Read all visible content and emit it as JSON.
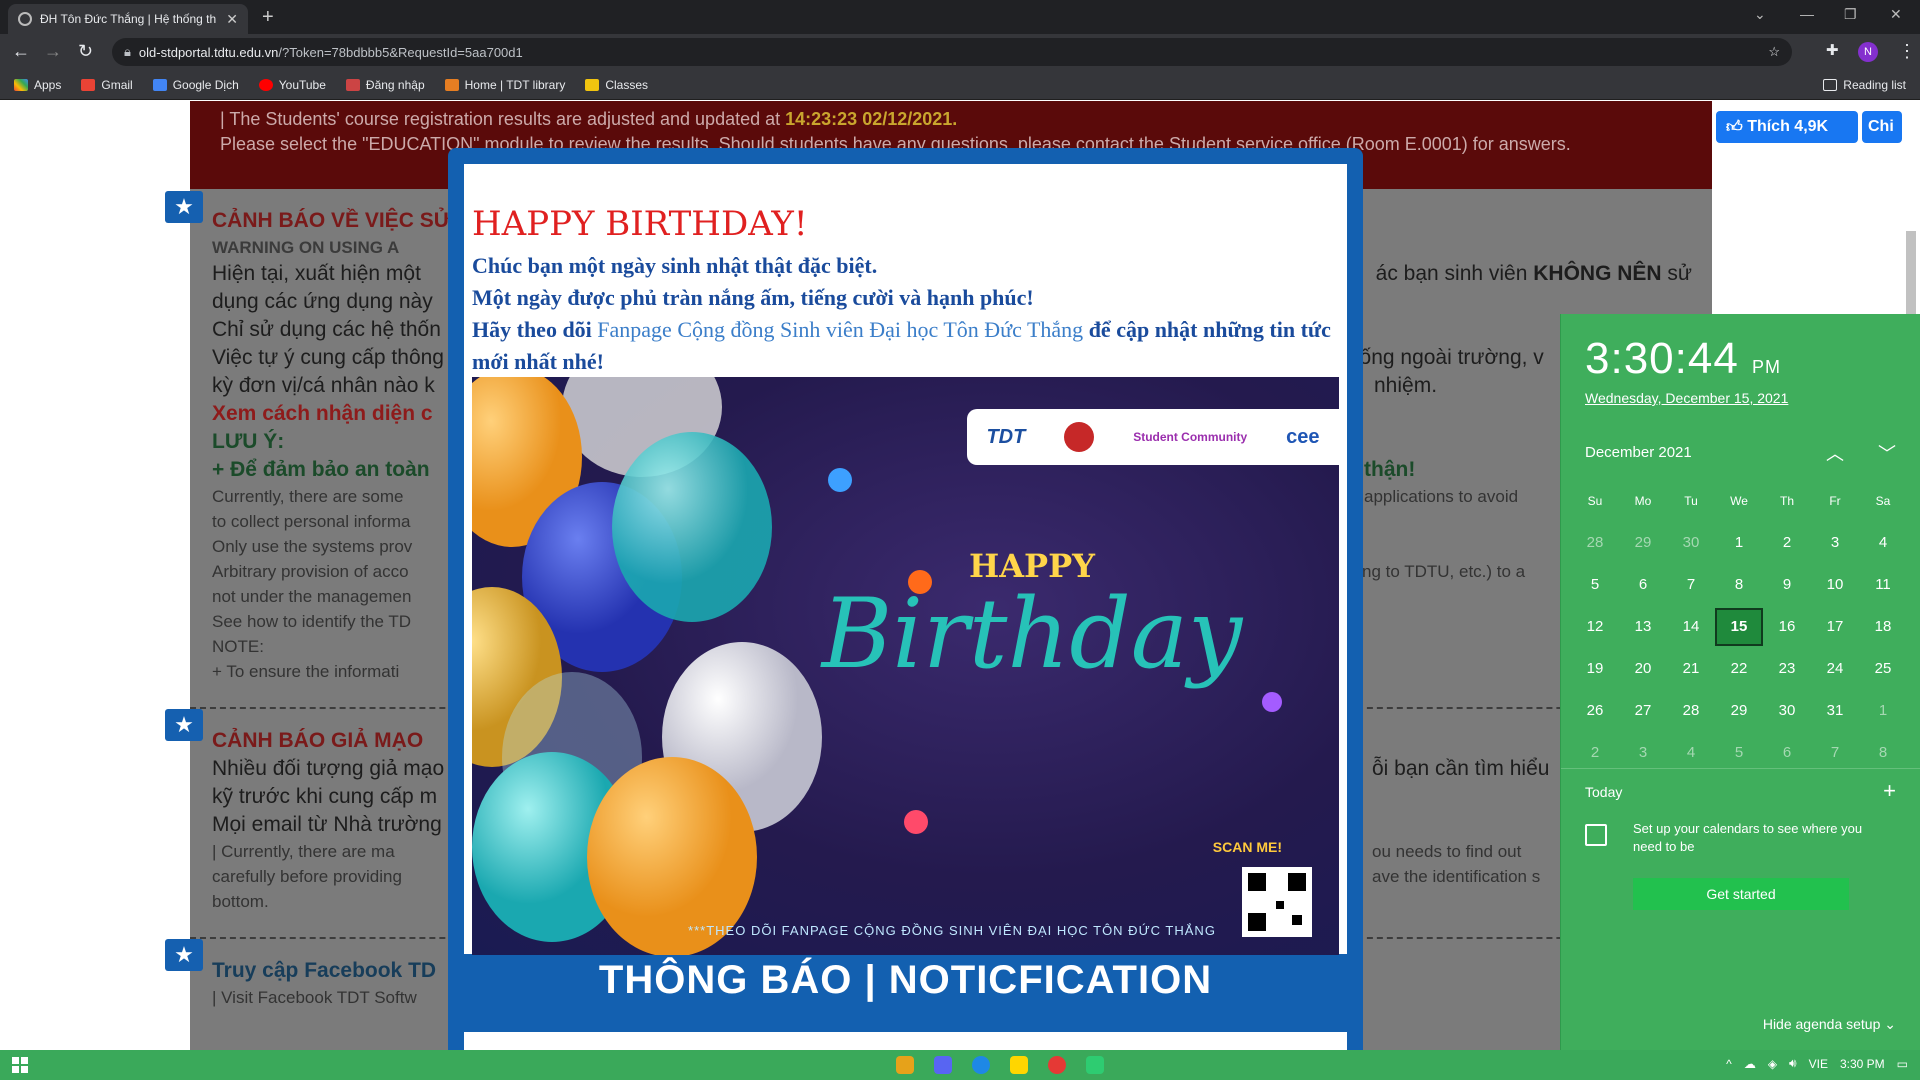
{
  "browser": {
    "tab_title": "ĐH Tôn Đức Thắng | Hệ thống th",
    "url_host": "old-stdportal.tdtu.edu.vn",
    "url_path": "/?Token=78bdbbb5&RequestId=5aa700d1",
    "bookmarks": [
      "Apps",
      "Gmail",
      "Google Dịch",
      "YouTube",
      "Đăng nhập",
      "Home | TDT library",
      "Classes"
    ],
    "reading_list": "Reading list",
    "profile_initial": "N"
  },
  "page": {
    "banner_line1_prefix": "| The Students' course registration results are adjusted and updated at ",
    "banner_line1_time": "14:23:23 02/12/2021.",
    "banner_line2": "Please select the \"EDUCATION\" module to review the results. Should students have any questions, please contact the Student service office (Room E.0001) for answers.",
    "fb_like": "Thích 4,9K",
    "fb_share": "Chi",
    "s1_title": "CẢNH BÁO VỀ VIỆC SỬ",
    "s1_title_en": "WARNING ON USING A",
    "s1_l1": "Hiện tại, xuất hiện một",
    "s1_l1_right_a": "ác bạn sinh viên ",
    "s1_l1_right_b": "KHÔNG NÊN",
    "s1_l1_right_c": " sử",
    "s1_l2": "dụng các ứng dụng này",
    "s1_l3": "Chỉ sử dụng các hệ thốn",
    "s1_l4": "Việc tự ý cung cấp thông",
    "s1_l4_right": "thống ngoài trường, v",
    "s1_l5": "kỳ đơn vị/cá nhân nào k",
    "s1_l5_right": "nhiệm.",
    "s1_link": "Xem cách nhận diện c",
    "s1_note": "LƯU Ý:",
    "s1_ensure": "+ Để đảm bảo an toàn",
    "s1_ensure_right": "thận!",
    "s1_en1": "Currently, there are some",
    "s1_en1_right": "applications to avoid",
    "s1_en2": "to collect personal informa",
    "s1_en3": "Only use the systems prov",
    "s1_en4": "Arbitrary provision of acco",
    "s1_en4_right": "ng to TDTU, etc.) to a",
    "s1_en5": "not under the managemen",
    "s1_en6": "See how to identify the TD",
    "s1_en7": "NOTE:",
    "s1_en8": "+ To ensure the informati",
    "s2_title": "CẢNH BÁO GIẢ MẠO",
    "s2_l1": "Nhiều đối tượng giả mạo",
    "s2_l1_right": "ỗi bạn cần tìm hiểu",
    "s2_l2": "kỹ trước khi cung cấp m",
    "s2_l3": "Mọi email từ Nhà trường",
    "s2_en1": "| Currently, there are ma",
    "s2_en1_right": "ou needs to find out",
    "s2_en2": "carefully before providing",
    "s2_en2_right": "ave the identification s",
    "s2_en3": "bottom.",
    "s3_title": "Truy cập Facebook TD",
    "s3_sub": "| Visit Facebook TDT Softw"
  },
  "modal": {
    "heading": "HAPPY BIRTHDAY!",
    "line1": "Chúc bạn một ngày sinh nhật thật đặc biệt.",
    "line2": "Một ngày được phủ tràn nắng ấm, tiếng cười và hạnh phúc!",
    "line3_a": "Hãy theo dõi ",
    "line3_link": "Fanpage Cộng đồng Sinh viên Đại học Tôn Đức Thắng",
    "line3_b": " để cập nhật những tin tức mới nhất nhé!",
    "art_happy": "HAPPY",
    "art_birthday": "Birthday",
    "art_scan": "SCAN ME!",
    "art_footer": "***THEO DÕI FANPAGE CỘNG ĐỒNG SINH VIÊN ĐẠI HỌC TÔN ĐỨC THẮNG",
    "logo_tdt": "TDT",
    "logo_sc": "Student Community",
    "logo_cee": "cee",
    "notification": "THÔNG BÁO | NOTICFICATION"
  },
  "calendar": {
    "time": "3:30:44",
    "ampm": "PM",
    "date": "Wednesday, December 15, 2021",
    "month": "December 2021",
    "weekdays": [
      "Su",
      "Mo",
      "Tu",
      "We",
      "Th",
      "Fr",
      "Sa"
    ],
    "days": [
      "28",
      "29",
      "30",
      "1",
      "2",
      "3",
      "4",
      "5",
      "6",
      "7",
      "8",
      "9",
      "10",
      "11",
      "12",
      "13",
      "14",
      "15",
      "16",
      "17",
      "18",
      "19",
      "20",
      "21",
      "22",
      "23",
      "24",
      "25",
      "26",
      "27",
      "28",
      "29",
      "30",
      "31",
      "1",
      "2",
      "3",
      "4",
      "5",
      "6",
      "7",
      "8"
    ],
    "today_label": "Today",
    "setup_text": "Set up your calendars to see where you need to be",
    "get_started": "Get started",
    "hide_agenda": "Hide agenda setup"
  },
  "taskbar": {
    "lang": "VIE",
    "time": "3:30 PM"
  }
}
